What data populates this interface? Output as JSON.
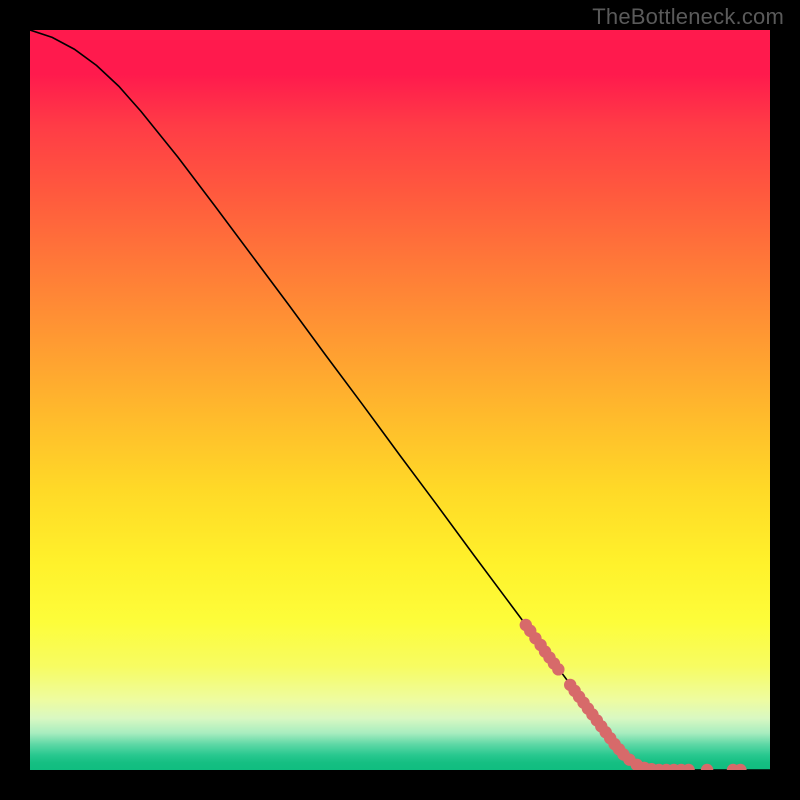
{
  "attribution": "TheBottleneck.com",
  "colors": {
    "marker_fill": "#d76a6a",
    "marker_stroke": "#d76a6a",
    "curve_stroke": "#000000"
  },
  "chart_data": {
    "type": "line",
    "title": "",
    "xlabel": "",
    "ylabel": "",
    "xlim": [
      0,
      100
    ],
    "ylim": [
      0,
      100
    ],
    "curve": [
      {
        "x": 0,
        "y": 100.0
      },
      {
        "x": 3,
        "y": 99.0
      },
      {
        "x": 6,
        "y": 97.4
      },
      {
        "x": 9,
        "y": 95.2
      },
      {
        "x": 12,
        "y": 92.4
      },
      {
        "x": 15,
        "y": 89.0
      },
      {
        "x": 20,
        "y": 82.8
      },
      {
        "x": 25,
        "y": 76.2
      },
      {
        "x": 30,
        "y": 69.5
      },
      {
        "x": 35,
        "y": 62.8
      },
      {
        "x": 40,
        "y": 56.0
      },
      {
        "x": 45,
        "y": 49.3
      },
      {
        "x": 50,
        "y": 42.5
      },
      {
        "x": 55,
        "y": 35.8
      },
      {
        "x": 60,
        "y": 29.0
      },
      {
        "x": 65,
        "y": 22.3
      },
      {
        "x": 70,
        "y": 15.6
      },
      {
        "x": 75,
        "y": 8.9
      },
      {
        "x": 78,
        "y": 4.9
      },
      {
        "x": 81,
        "y": 1.5
      },
      {
        "x": 83,
        "y": 0.4
      },
      {
        "x": 85,
        "y": 0.0
      },
      {
        "x": 90,
        "y": 0.0
      },
      {
        "x": 95,
        "y": 0.0
      },
      {
        "x": 100,
        "y": 0.0
      }
    ],
    "markers": [
      {
        "x": 67.0,
        "y": 19.6
      },
      {
        "x": 67.6,
        "y": 18.8
      },
      {
        "x": 68.3,
        "y": 17.8
      },
      {
        "x": 69.0,
        "y": 16.9
      },
      {
        "x": 69.6,
        "y": 16.0
      },
      {
        "x": 70.2,
        "y": 15.2
      },
      {
        "x": 70.8,
        "y": 14.4
      },
      {
        "x": 71.4,
        "y": 13.6
      },
      {
        "x": 73.0,
        "y": 11.5
      },
      {
        "x": 73.6,
        "y": 10.7
      },
      {
        "x": 74.2,
        "y": 9.9
      },
      {
        "x": 74.8,
        "y": 9.1
      },
      {
        "x": 75.4,
        "y": 8.3
      },
      {
        "x": 76.0,
        "y": 7.5
      },
      {
        "x": 76.6,
        "y": 6.7
      },
      {
        "x": 77.2,
        "y": 5.9
      },
      {
        "x": 77.8,
        "y": 5.1
      },
      {
        "x": 78.4,
        "y": 4.3
      },
      {
        "x": 79.0,
        "y": 3.5
      },
      {
        "x": 79.6,
        "y": 2.8
      },
      {
        "x": 80.2,
        "y": 2.1
      },
      {
        "x": 81.0,
        "y": 1.4
      },
      {
        "x": 82.0,
        "y": 0.7
      },
      {
        "x": 83.0,
        "y": 0.3
      },
      {
        "x": 84.0,
        "y": 0.1
      },
      {
        "x": 85.0,
        "y": 0.0
      },
      {
        "x": 86.0,
        "y": 0.0
      },
      {
        "x": 87.0,
        "y": 0.0
      },
      {
        "x": 88.0,
        "y": 0.0
      },
      {
        "x": 89.0,
        "y": 0.0
      },
      {
        "x": 91.5,
        "y": 0.0
      },
      {
        "x": 95.0,
        "y": 0.0
      },
      {
        "x": 96.0,
        "y": 0.0
      }
    ]
  }
}
